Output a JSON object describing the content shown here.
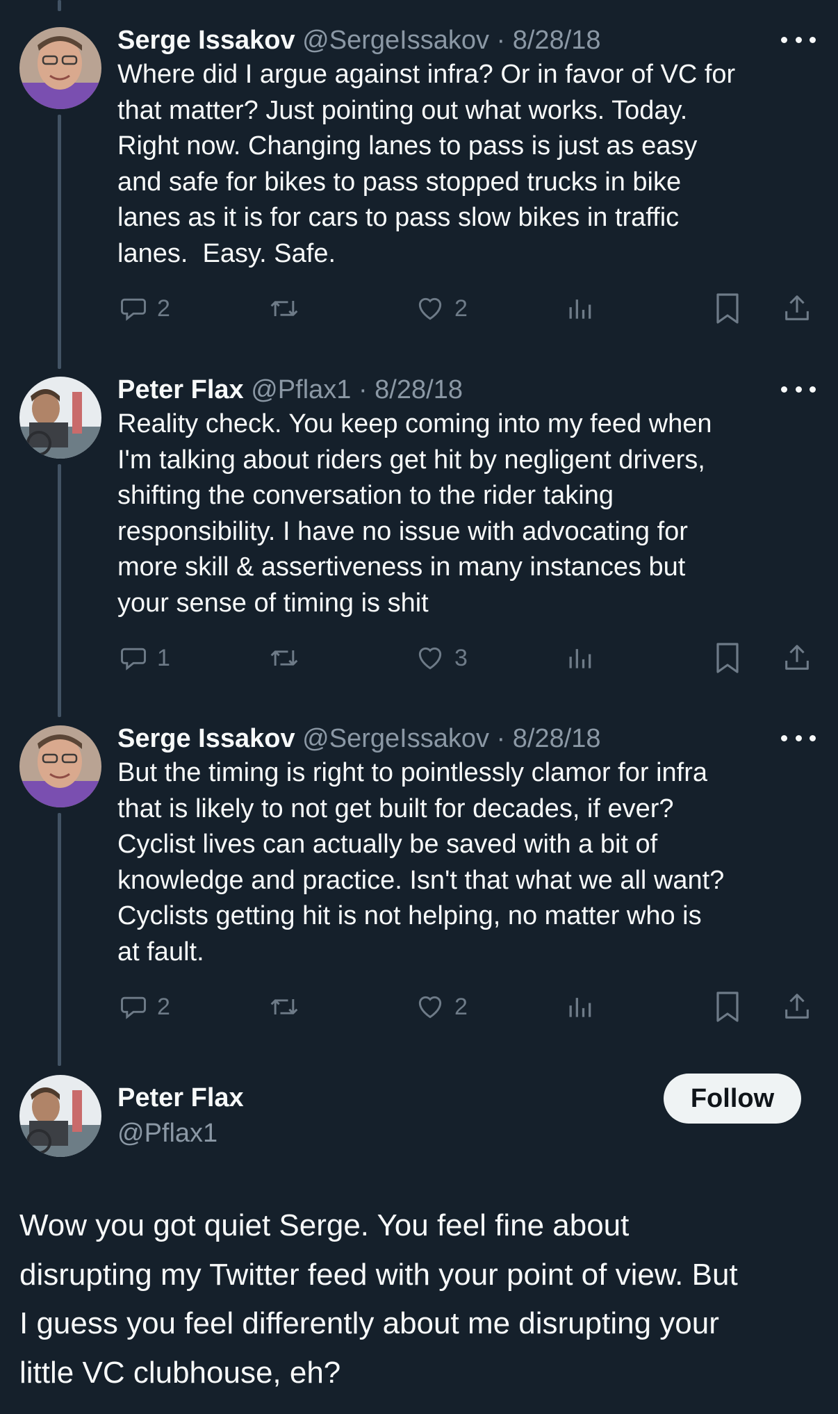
{
  "replies": [
    {
      "name": "Serge Issakov",
      "meta": "@SergeIssakov · 8/28/18",
      "text": "Where did I argue against infra? Or in favor of VC for\nthat matter? Just pointing out what works. Today.\nRight now. Changing lanes to pass is just as easy\nand safe for bikes to pass stopped trucks in bike\nlanes as it is for cars to pass slow bikes in traffic\nlanes.  Easy. Safe.",
      "reply_count": "2",
      "retweet_count": "",
      "like_count": "2",
      "avatar": "serge-avatar"
    },
    {
      "name": "Peter Flax",
      "meta": "@Pflax1 · 8/28/18",
      "text": "Reality check. You keep coming into my feed when\nI'm talking about riders get hit by negligent drivers,\nshifting the conversation to the rider taking\nresponsibility. I have no issue with advocating for\nmore skill & assertiveness in many instances but\nyour sense of timing is shit",
      "reply_count": "1",
      "retweet_count": "",
      "like_count": "3",
      "avatar": "peter-avatar"
    },
    {
      "name": "Serge Issakov",
      "meta": "@SergeIssakov · 8/28/18",
      "text": "But the timing is right to pointlessly clamor for infra\nthat is likely to not get built for decades, if ever?\nCyclist lives can actually be saved with a bit of\nknowledge and practice. Isn't that what we all want?\nCyclists getting hit is not helping, no matter who is\nat fault.",
      "reply_count": "2",
      "retweet_count": "",
      "like_count": "2",
      "avatar": "serge-avatar"
    }
  ],
  "main_tweet": {
    "name": "Peter Flax",
    "handle": "@Pflax1",
    "follow_label": "Follow",
    "text": "Wow you got quiet Serge. You feel fine about\ndisrupting my Twitter feed with your point of view. But\nI guess you feel differently about me disrupting your\nlittle VC clubhouse, eh?"
  },
  "colors": {
    "background": "#15202b",
    "text": "#f7f9f9",
    "secondary": "#8b98a5",
    "icon": "#6e7b88",
    "thread_line": "#425364",
    "follow_bg": "#eff3f4"
  },
  "icons": [
    "reply-icon",
    "retweet-icon",
    "like-icon",
    "views-icon",
    "bookmark-icon",
    "share-icon",
    "more-icon"
  ]
}
